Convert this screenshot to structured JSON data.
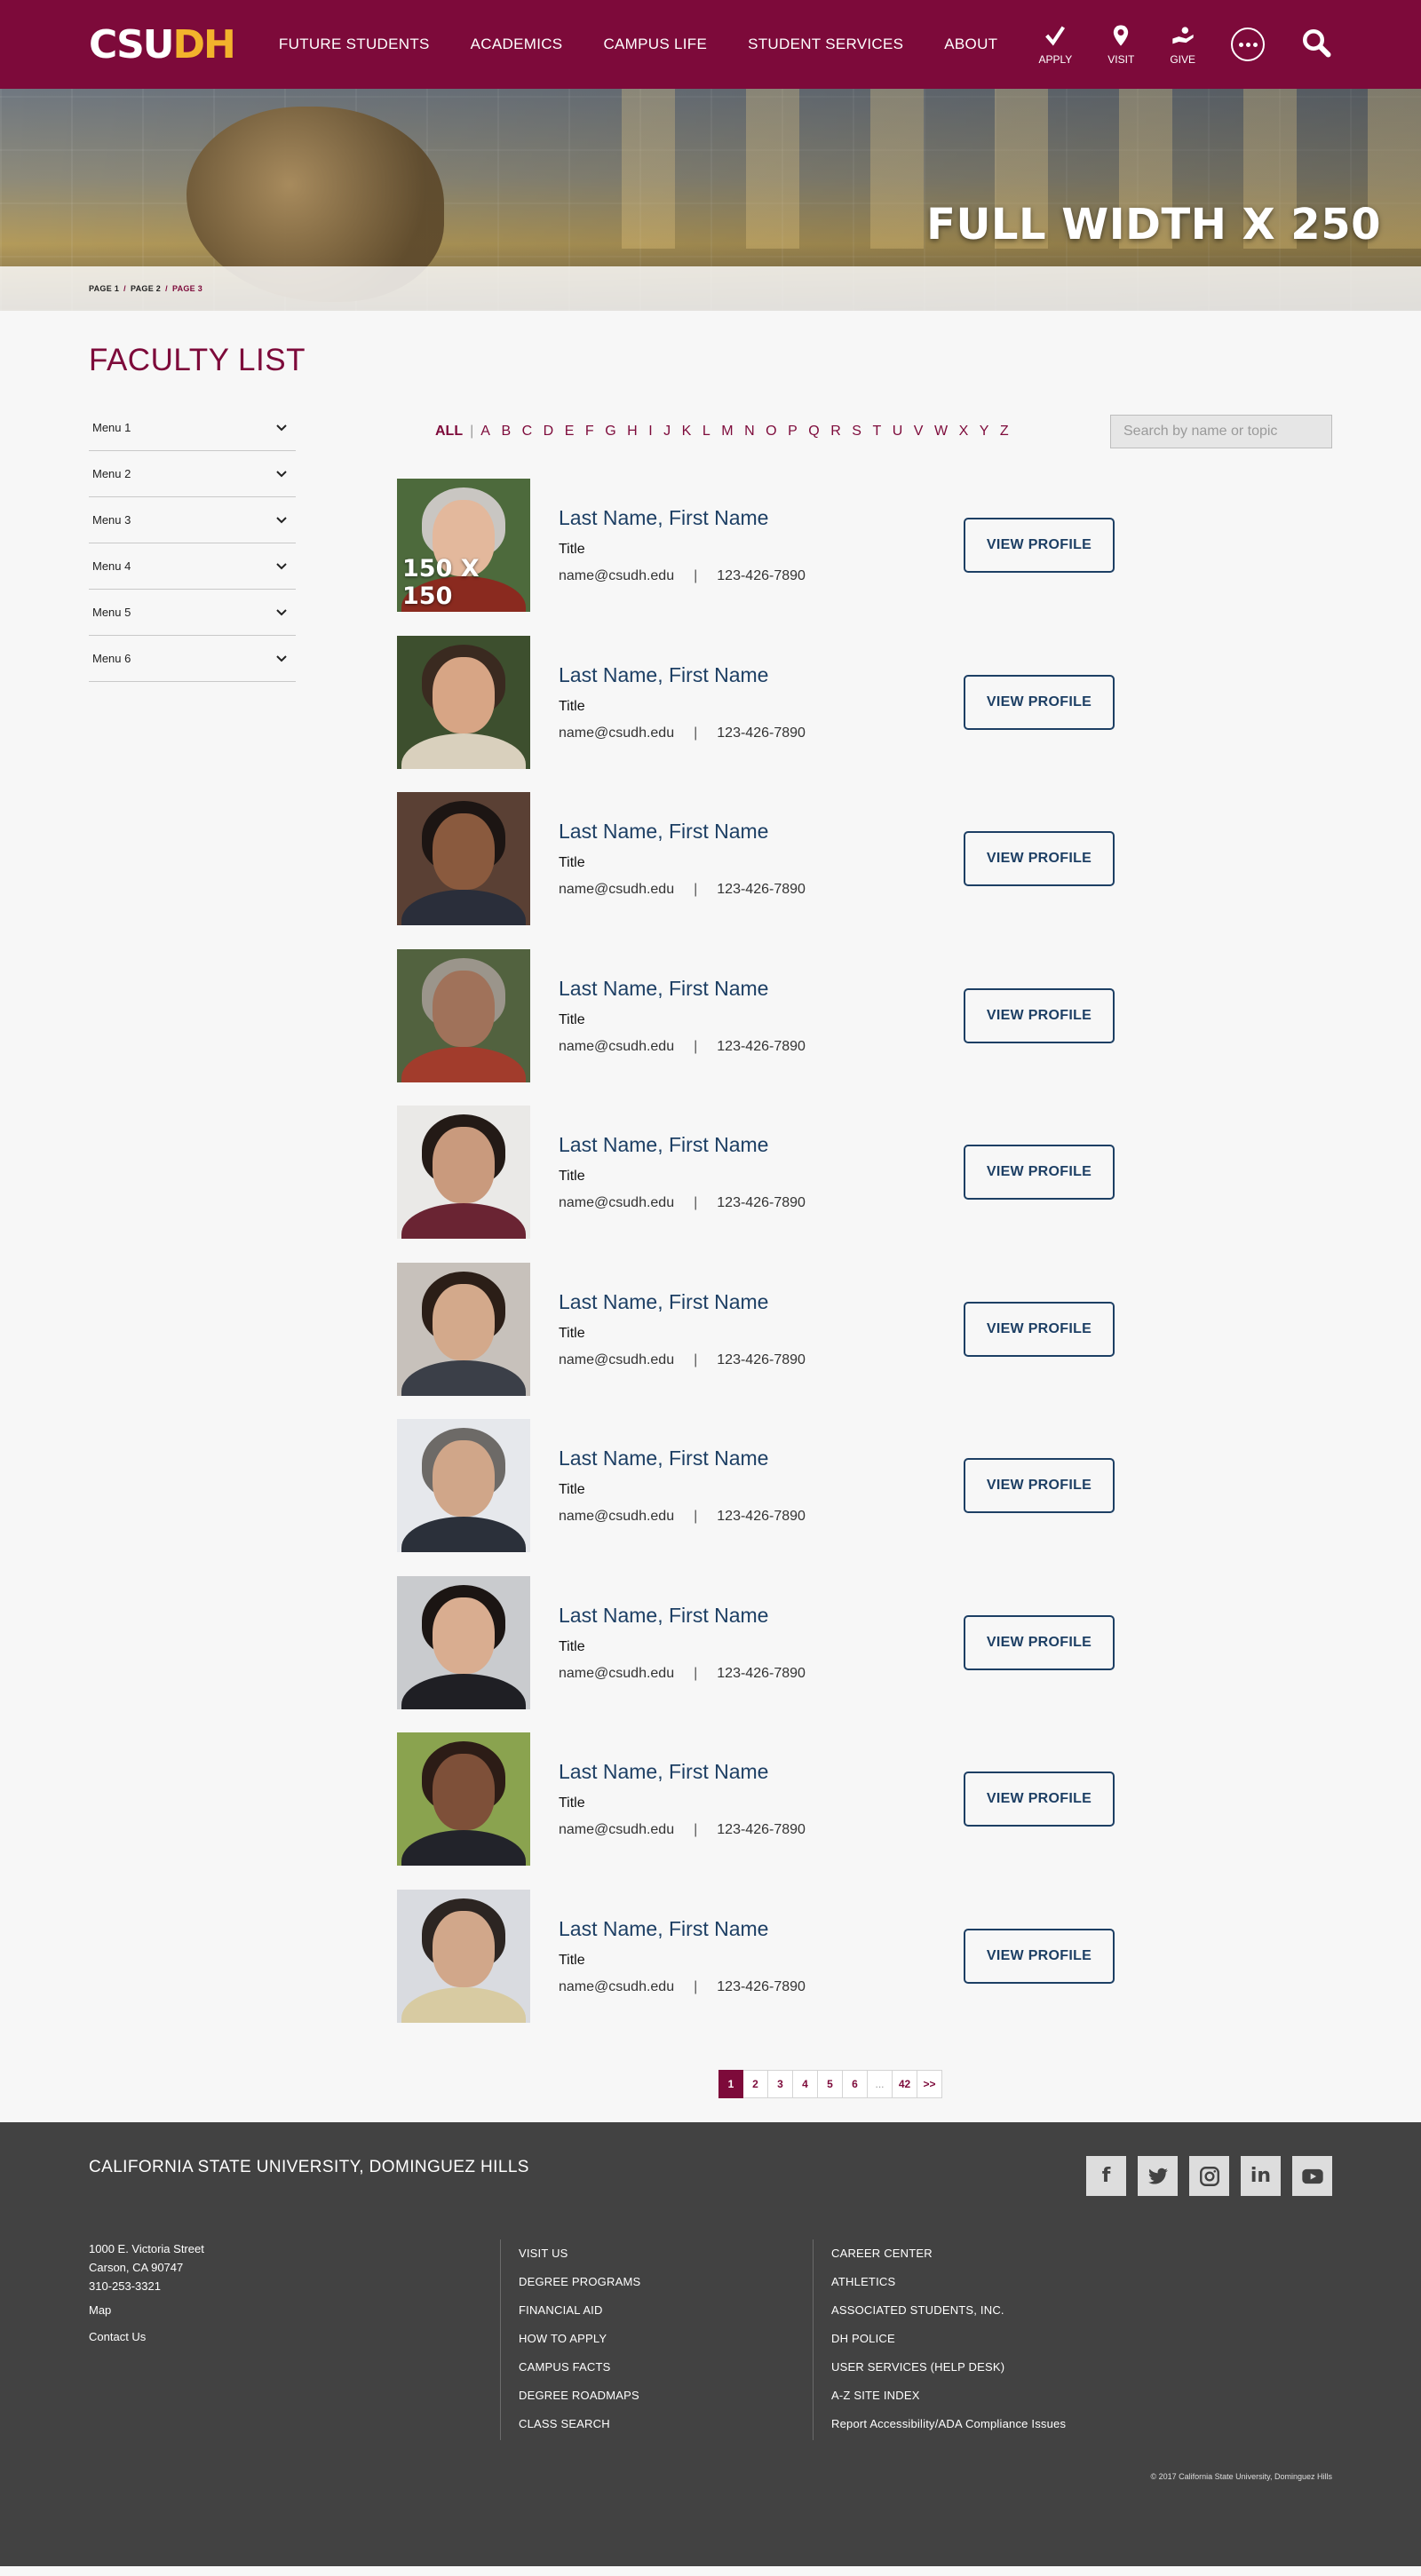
{
  "header": {
    "logo_cs": "CSU",
    "logo_dh": "DH",
    "nav": [
      "FUTURE STUDENTS",
      "ACADEMICS",
      "CAMPUS LIFE",
      "STUDENT SERVICES",
      "ABOUT"
    ],
    "quick": {
      "apply": "APPLY",
      "visit": "VISIT",
      "give": "GIVE"
    }
  },
  "hero": {
    "title": "FULL WIDTH X 250",
    "breadcrumb": [
      "PAGE 1",
      "PAGE 2",
      "PAGE 3"
    ]
  },
  "page_title": "FACULTY LIST",
  "sidebar": [
    "Menu 1",
    "Menu 2",
    "Menu 3",
    "Menu 4",
    "Menu 5",
    "Menu 6"
  ],
  "filter": {
    "all": "ALL",
    "letters": [
      "A",
      "B",
      "C",
      "D",
      "E",
      "F",
      "G",
      "H",
      "I",
      "J",
      "K",
      "L",
      "M",
      "N",
      "O",
      "P",
      "Q",
      "R",
      "S",
      "T",
      "U",
      "V",
      "W",
      "X",
      "Y",
      "Z"
    ],
    "search_placeholder": "Search by name or topic"
  },
  "placeholder_photo_label": "150 X 150",
  "people": [
    {
      "name": "Last Name, First Name",
      "title": "Title",
      "email": "name@csudh.edu",
      "phone": "123-426-7890",
      "button": "VIEW PROFILE"
    },
    {
      "name": "Last Name, First Name",
      "title": "Title",
      "email": "name@csudh.edu",
      "phone": "123-426-7890",
      "button": "VIEW PROFILE"
    },
    {
      "name": "Last Name, First Name",
      "title": "Title",
      "email": "name@csudh.edu",
      "phone": "123-426-7890",
      "button": "VIEW PROFILE"
    },
    {
      "name": "Last Name, First Name",
      "title": "Title",
      "email": "name@csudh.edu",
      "phone": "123-426-7890",
      "button": "VIEW PROFILE"
    },
    {
      "name": "Last Name, First Name",
      "title": "Title",
      "email": "name@csudh.edu",
      "phone": "123-426-7890",
      "button": "VIEW PROFILE"
    },
    {
      "name": "Last Name, First Name",
      "title": "Title",
      "email": "name@csudh.edu",
      "phone": "123-426-7890",
      "button": "VIEW PROFILE"
    },
    {
      "name": "Last Name, First Name",
      "title": "Title",
      "email": "name@csudh.edu",
      "phone": "123-426-7890",
      "button": "VIEW PROFILE"
    },
    {
      "name": "Last Name, First Name",
      "title": "Title",
      "email": "name@csudh.edu",
      "phone": "123-426-7890",
      "button": "VIEW PROFILE"
    },
    {
      "name": "Last Name, First Name",
      "title": "Title",
      "email": "name@csudh.edu",
      "phone": "123-426-7890",
      "button": "VIEW PROFILE"
    },
    {
      "name": "Last Name, First Name",
      "title": "Title",
      "email": "name@csudh.edu",
      "phone": "123-426-7890",
      "button": "VIEW PROFILE"
    }
  ],
  "pagination": [
    "1",
    "2",
    "3",
    "4",
    "5",
    "6",
    "...",
    "42",
    ">>"
  ],
  "footer": {
    "title": "CALIFORNIA STATE UNIVERSITY, DOMINGUEZ HILLS",
    "address": [
      "1000 E. Victoria Street",
      "Carson, CA 90747",
      "310-253-3321"
    ],
    "address_links": [
      "Map",
      "Contact Us"
    ],
    "col1": [
      "VISIT US",
      "DEGREE PROGRAMS",
      "FINANCIAL AID",
      "HOW TO APPLY",
      "CAMPUS FACTS",
      "DEGREE ROADMAPS",
      "CLASS SEARCH"
    ],
    "col2": [
      "CAREER CENTER",
      "ATHLETICS",
      "ASSOCIATED STUDENTS, INC.",
      "DH POLICE",
      "USER SERVICES (HELP DESK)",
      "A-Z SITE INDEX",
      "Report Accessibility/ADA Compliance Issues"
    ],
    "social": [
      "f",
      "t",
      "ig",
      "in",
      "yt"
    ],
    "copyright": "© 2017 California State University, Dominguez Hills"
  },
  "colors": {
    "brand": "#7d0a3a",
    "gold": "#f3b32c",
    "navy": "#1d3f64",
    "footer": "#424242"
  }
}
